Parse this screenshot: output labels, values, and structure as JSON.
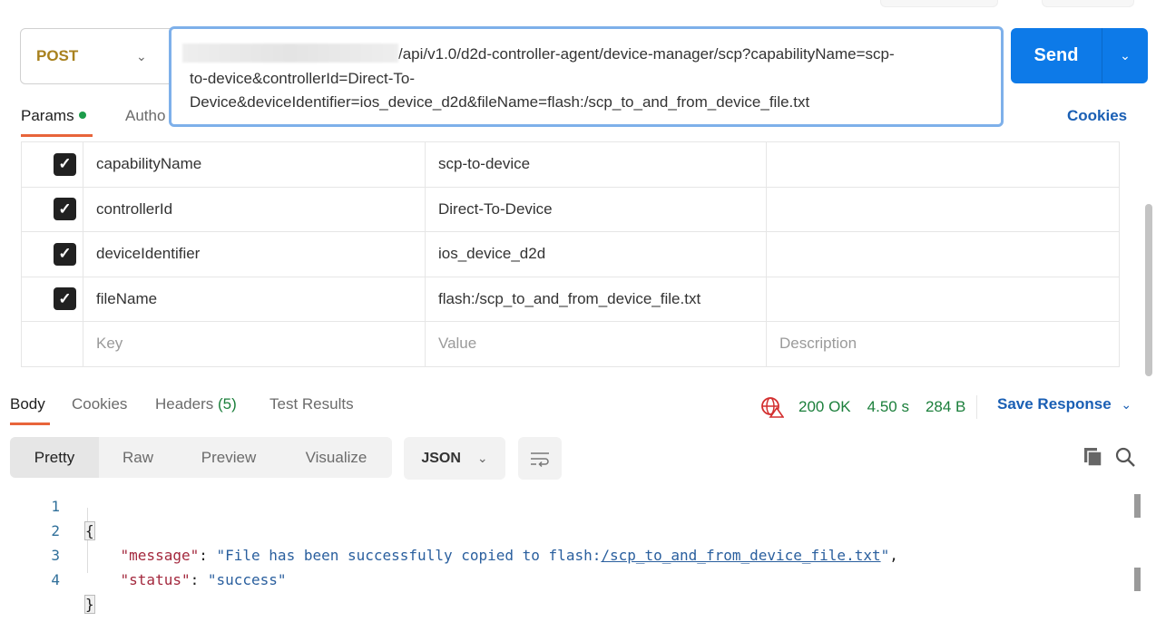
{
  "request": {
    "method": "POST",
    "url_lines": [
      "/api/v1.0/d2d-controller-agent/device-manager/scp?capabilityName=scp-",
      "to-device&controllerId=Direct-To-",
      "Device&deviceIdentifier=ios_device_d2d&fileName=flash:/scp_to_and_from_device_file.txt"
    ],
    "send_label": "Send",
    "tabs": {
      "params": "Params",
      "auth": "Autho"
    },
    "cookies_label": "Cookies"
  },
  "params": {
    "rows": [
      {
        "key": "capabilityName",
        "value": "scp-to-device",
        "checked": true
      },
      {
        "key": "controllerId",
        "value": "Direct-To-Device",
        "checked": true
      },
      {
        "key": "deviceIdentifier",
        "value": "ios_device_d2d",
        "checked": true
      },
      {
        "key": "fileName",
        "value": "flash:/scp_to_and_from_device_file.txt",
        "checked": true
      }
    ],
    "placeholders": {
      "key": "Key",
      "value": "Value",
      "description": "Description"
    }
  },
  "response": {
    "tabs": {
      "body": "Body",
      "cookies": "Cookies",
      "headers": "Headers",
      "headers_count": "(5)",
      "tests": "Test Results"
    },
    "status": "200 OK",
    "time": "4.50 s",
    "size": "284 B",
    "save_label": "Save Response",
    "views": [
      "Pretty",
      "Raw",
      "Preview",
      "Visualize"
    ],
    "format": "JSON",
    "line_numbers": [
      "1",
      "2",
      "3",
      "4"
    ],
    "body": {
      "open": "{",
      "message_key": "\"message\"",
      "message_prefix": "\"File has been successfully copied to flash:",
      "message_link": "/scp_to_and_from_device_file.txt",
      "message_suffix": "\"",
      "status_key": "\"status\"",
      "status_value": "\"success\"",
      "close": "}"
    }
  }
}
